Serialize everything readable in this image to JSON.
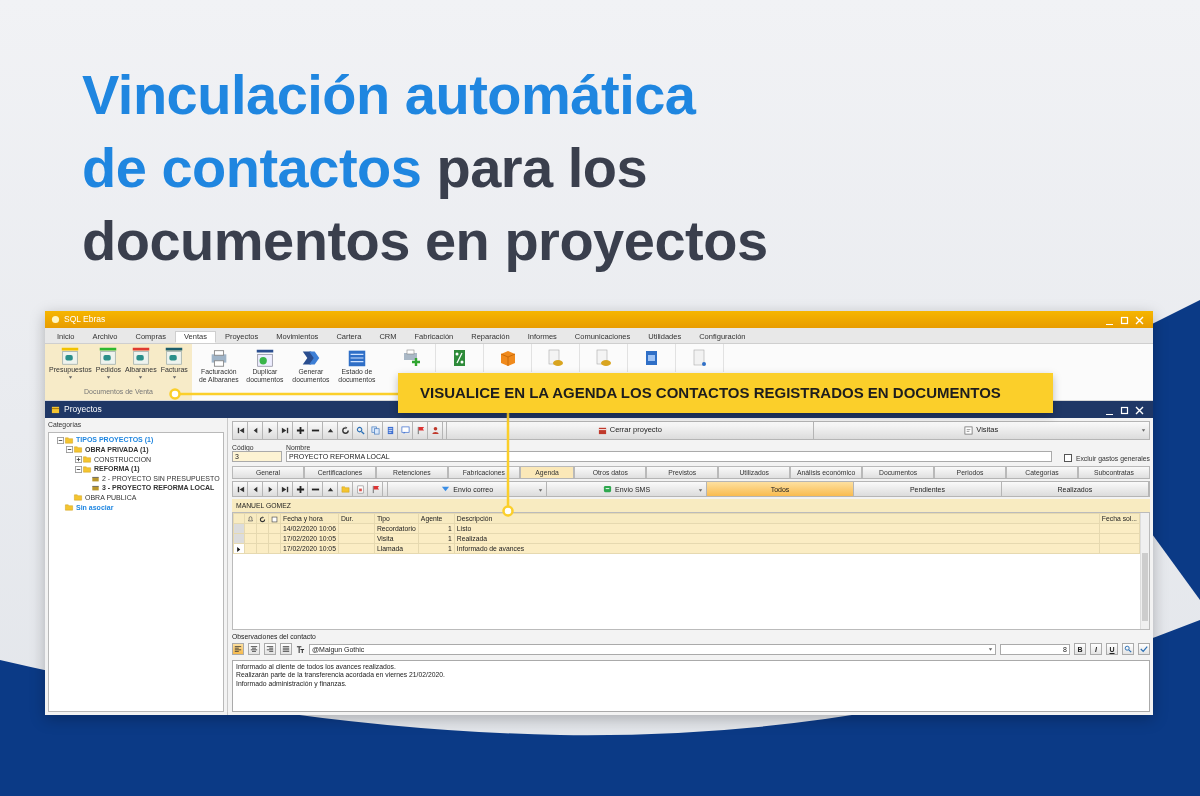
{
  "heading": {
    "lines": [
      [
        {
          "text": "Vinculación automática",
          "accent": true
        }
      ],
      [
        {
          "text": "de contactos",
          "accent": true
        },
        {
          "text": "para los",
          "accent": false
        }
      ],
      [
        {
          "text": "documentos en proyectos",
          "accent": false
        }
      ]
    ]
  },
  "callout": {
    "text": "VISUALICE EN LA AGENDA LOS CONTACTOS REGISTRADOS EN DOCUMENTOS"
  },
  "window": {
    "title": "SQL Ebras"
  },
  "menu_tabs": [
    {
      "label": "Inicio",
      "selected": false
    },
    {
      "label": "Archivo",
      "selected": false
    },
    {
      "label": "Compras",
      "selected": false
    },
    {
      "label": "Ventas",
      "selected": true
    },
    {
      "label": "Proyectos",
      "selected": false
    },
    {
      "label": "Movimientos",
      "selected": false
    },
    {
      "label": "Cartera",
      "selected": false
    },
    {
      "label": "CRM",
      "selected": false
    },
    {
      "label": "Fabricación",
      "selected": false
    },
    {
      "label": "Reparación",
      "selected": false
    },
    {
      "label": "Informes",
      "selected": false
    },
    {
      "label": "Comunicaciones",
      "selected": false
    },
    {
      "label": "Utilidades",
      "selected": false
    },
    {
      "label": "Configuración",
      "selected": false
    }
  ],
  "ribbon": {
    "sales_group": {
      "label": "Documentos de Venta",
      "buttons": [
        {
          "label": "Presupuestos",
          "color": "#f2c200"
        },
        {
          "label": "Pedidos",
          "color": "#2eb82e"
        },
        {
          "label": "Albaranes",
          "color": "#e03a2f"
        },
        {
          "label": "Facturas",
          "color": "#1b5e6b"
        }
      ]
    },
    "process_buttons": [
      {
        "label": "Facturación de Albaranes"
      },
      {
        "label": "Duplicar documentos"
      },
      {
        "label": "Generar documentos"
      },
      {
        "label": "Estado de documentos"
      }
    ]
  },
  "child_window": {
    "title": "Proyectos"
  },
  "tree": {
    "label": "Categorías",
    "items": [
      {
        "label": "TIPOS PROYECTOS (1)",
        "kind": "root",
        "expanded": true,
        "children": [
          {
            "label": "OBRA PRIVADA (1)",
            "kind": "folder",
            "expanded": true,
            "children": [
              {
                "label": "CONSTRUCCION",
                "kind": "folder",
                "expanded": false
              },
              {
                "label": "REFORMA (1)",
                "kind": "folder",
                "expanded": true,
                "children": [
                  {
                    "label": "2 - PROYECTO SIN PRESUPUESTO",
                    "kind": "project",
                    "selected": false
                  },
                  {
                    "label": "3 - PROYECTO REFORMA LOCAL",
                    "kind": "project",
                    "selected": true
                  }
                ]
              }
            ]
          },
          {
            "label": "OBRA PUBLICA",
            "kind": "folder"
          }
        ]
      },
      {
        "label": "Sin asociar",
        "kind": "root"
      }
    ]
  },
  "toolbar": {
    "close_button": "Cerrar proyecto",
    "view_dropdown": "Visitas"
  },
  "fields": {
    "codigo": {
      "label": "Código",
      "value": "3"
    },
    "nombre": {
      "label": "Nombre",
      "value": "PROYECTO REFORMA LOCAL"
    },
    "excluir": {
      "label": "Excluir gastos generales",
      "checked": false
    }
  },
  "tabs": [
    {
      "label": "General",
      "selected": false
    },
    {
      "label": "Certificaciones",
      "selected": false
    },
    {
      "label": "Retenciones",
      "selected": false
    },
    {
      "label": "Fabricaciones",
      "selected": false
    },
    {
      "label": "Agenda",
      "selected": true
    },
    {
      "label": "Otros datos",
      "selected": false
    },
    {
      "label": "Previstos",
      "selected": false
    },
    {
      "label": "Utilizados",
      "selected": false
    },
    {
      "label": "Análisis económico",
      "selected": false
    },
    {
      "label": "Documentos",
      "selected": false
    },
    {
      "label": "Periodos",
      "selected": false
    },
    {
      "label": "Categorías",
      "selected": false
    },
    {
      "label": "Subcontratas",
      "selected": false
    }
  ],
  "agenda": {
    "email_dropdown": "Envío correo",
    "sms_dropdown": "Envío SMS",
    "filters": [
      {
        "label": "Todos",
        "selected": true
      },
      {
        "label": "Pendientes",
        "selected": false
      },
      {
        "label": "Realizados",
        "selected": false
      }
    ],
    "contact": "MANUEL GOMEZ",
    "columns": [
      "Fecha y hora",
      "Dur.",
      "Tipo",
      "Agente",
      "Descripción",
      "Fecha sol..."
    ],
    "rows": [
      {
        "fecha": "14/02/2020 10:06",
        "tipo": "Recordatorio",
        "agente": "1",
        "descripcion": "Listo",
        "selected": false
      },
      {
        "fecha": "17/02/2020 10:05",
        "tipo": "Visita",
        "agente": "1",
        "descripcion": "Realizada",
        "selected": false
      },
      {
        "fecha": "17/02/2020 10:05",
        "tipo": "Llamada",
        "agente": "1",
        "descripcion": "Informado de avances",
        "selected": true
      }
    ]
  },
  "observaciones": {
    "label": "Observaciones del contacto",
    "align_buttons": [
      {
        "selected": true
      },
      {
        "selected": false
      },
      {
        "selected": false
      },
      {
        "selected": false
      }
    ],
    "font": "@Malgun Gothic",
    "size": "8",
    "style_buttons": [
      "B",
      "I",
      "U"
    ],
    "lines": [
      "Informado al cliente de todos los avances realizados.",
      "Realizarán parte de la transferencia acordada en viernes 21/02/2020.",
      "Informado administración y finanzas."
    ]
  }
}
